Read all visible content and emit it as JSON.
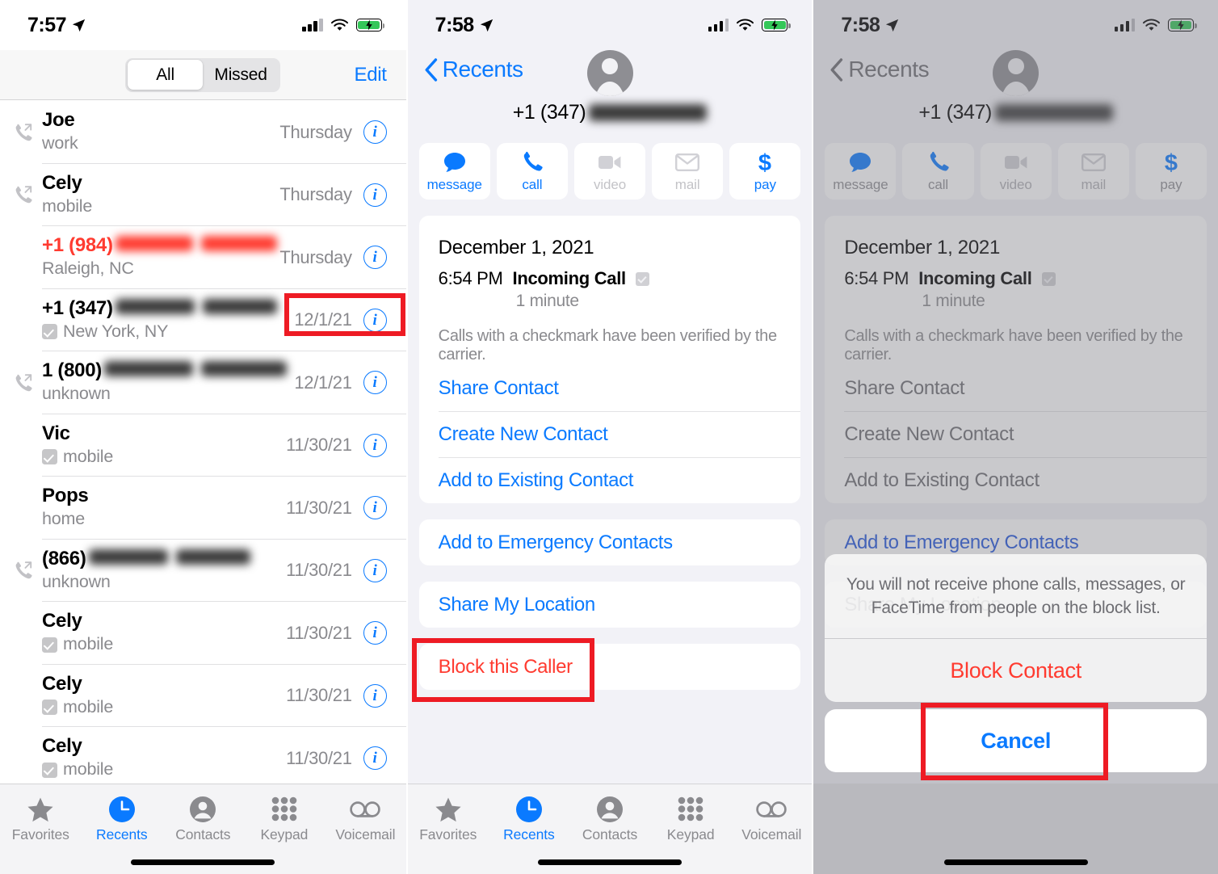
{
  "panel1": {
    "status": {
      "time": "7:57"
    },
    "segmented": {
      "options": [
        "All",
        "Missed"
      ],
      "selected": "All"
    },
    "edit_label": "Edit",
    "calls": [
      {
        "name": "Joe",
        "sub": "work",
        "date": "Thursday",
        "direction": "outgoing",
        "verified": false,
        "redacted": false,
        "red": false
      },
      {
        "name": "Cely",
        "sub": "mobile",
        "date": "Thursday",
        "direction": "outgoing",
        "verified": false,
        "redacted": false,
        "red": false
      },
      {
        "name": "+1 (984)",
        "sub": "Raleigh, NC",
        "date": "Thursday",
        "direction": "none",
        "verified": false,
        "redacted": true,
        "red": true
      },
      {
        "name": "+1 (347)",
        "sub": "New York, NY",
        "date": "12/1/21",
        "direction": "none",
        "verified": true,
        "redacted": true,
        "red": false
      },
      {
        "name": "1 (800)",
        "sub": "unknown",
        "date": "12/1/21",
        "direction": "outgoing",
        "verified": false,
        "redacted": true,
        "red": false
      },
      {
        "name": "Vic",
        "sub": "mobile",
        "date": "11/30/21",
        "direction": "none",
        "verified": true,
        "redacted": false,
        "red": false
      },
      {
        "name": "Pops",
        "sub": "home",
        "date": "11/30/21",
        "direction": "none",
        "verified": false,
        "redacted": false,
        "red": false
      },
      {
        "name": "(866)",
        "sub": "unknown",
        "date": "11/30/21",
        "direction": "outgoing",
        "verified": false,
        "redacted": true,
        "red": false
      },
      {
        "name": "Cely",
        "sub": "mobile",
        "date": "11/30/21",
        "direction": "none",
        "verified": true,
        "redacted": false,
        "red": false
      },
      {
        "name": "Cely",
        "sub": "mobile",
        "date": "11/30/21",
        "direction": "none",
        "verified": true,
        "redacted": false,
        "red": false
      },
      {
        "name": "Cely",
        "sub": "mobile",
        "date": "11/30/21",
        "direction": "none",
        "verified": true,
        "redacted": false,
        "red": false
      }
    ],
    "tabs": [
      {
        "label": "Favorites",
        "icon": "star-icon",
        "active": false
      },
      {
        "label": "Recents",
        "icon": "clock-icon",
        "active": true
      },
      {
        "label": "Contacts",
        "icon": "person-circle-icon",
        "active": false
      },
      {
        "label": "Keypad",
        "icon": "keypad-icon",
        "active": false
      },
      {
        "label": "Voicemail",
        "icon": "voicemail-icon",
        "active": false
      }
    ]
  },
  "panel2": {
    "status": {
      "time": "7:58"
    },
    "back_label": "Recents",
    "phone_number": "+1 (347)",
    "actions": [
      {
        "label": "message",
        "icon": "message-bubble-icon",
        "enabled": true
      },
      {
        "label": "call",
        "icon": "phone-handset-icon",
        "enabled": true
      },
      {
        "label": "video",
        "icon": "video-camera-icon",
        "enabled": false
      },
      {
        "label": "mail",
        "icon": "envelope-icon",
        "enabled": false
      },
      {
        "label": "pay",
        "icon": "dollar-sign-icon",
        "enabled": true
      }
    ],
    "call_detail": {
      "date": "December 1, 2021",
      "time": "6:54 PM",
      "type": "Incoming Call",
      "duration": "1 minute",
      "note": "Calls with a checkmark have been verified by the carrier."
    },
    "menu_group_1": [
      "Share Contact",
      "Create New Contact",
      "Add to Existing Contact"
    ],
    "menu_group_2": [
      "Add to Emergency Contacts"
    ],
    "menu_group_3": [
      "Share My Location"
    ],
    "menu_group_4": [
      "Block this Caller"
    ],
    "tabs": [
      {
        "label": "Favorites",
        "icon": "star-icon",
        "active": false
      },
      {
        "label": "Recents",
        "icon": "clock-icon",
        "active": true
      },
      {
        "label": "Contacts",
        "icon": "person-circle-icon",
        "active": false
      },
      {
        "label": "Keypad",
        "icon": "keypad-icon",
        "active": false
      },
      {
        "label": "Voicemail",
        "icon": "voicemail-icon",
        "active": false
      }
    ]
  },
  "panel3": {
    "status": {
      "time": "7:58"
    },
    "back_label": "Recents",
    "phone_number": "+1 (347)",
    "actions": [
      {
        "label": "message",
        "icon": "message-bubble-icon",
        "enabled": true
      },
      {
        "label": "call",
        "icon": "phone-handset-icon",
        "enabled": true
      },
      {
        "label": "video",
        "icon": "video-camera-icon",
        "enabled": false
      },
      {
        "label": "mail",
        "icon": "envelope-icon",
        "enabled": false
      },
      {
        "label": "pay",
        "icon": "dollar-sign-icon",
        "enabled": true
      }
    ],
    "call_detail": {
      "date": "December 1, 2021",
      "time": "6:54 PM",
      "type": "Incoming Call",
      "duration": "1 minute",
      "note": "Calls with a checkmark have been verified by the carrier."
    },
    "menu_group_1": [
      "Share Contact",
      "Create New Contact",
      "Add to Existing Contact"
    ],
    "menu_group_2": [
      "Add to Emergency Contacts"
    ],
    "menu_group_3": [
      "Share My Location"
    ],
    "action_sheet": {
      "message": "You will not receive phone calls, messages, or FaceTime from people on the block list.",
      "confirm_label": "Block Contact",
      "cancel_label": "Cancel"
    }
  },
  "colors": {
    "accent_blue": "#0a7aff",
    "danger_red": "#ff3b30",
    "annotation_red": "#ee1b24",
    "secondary_gray": "#8a8a8e",
    "battery_green": "#35c759"
  }
}
